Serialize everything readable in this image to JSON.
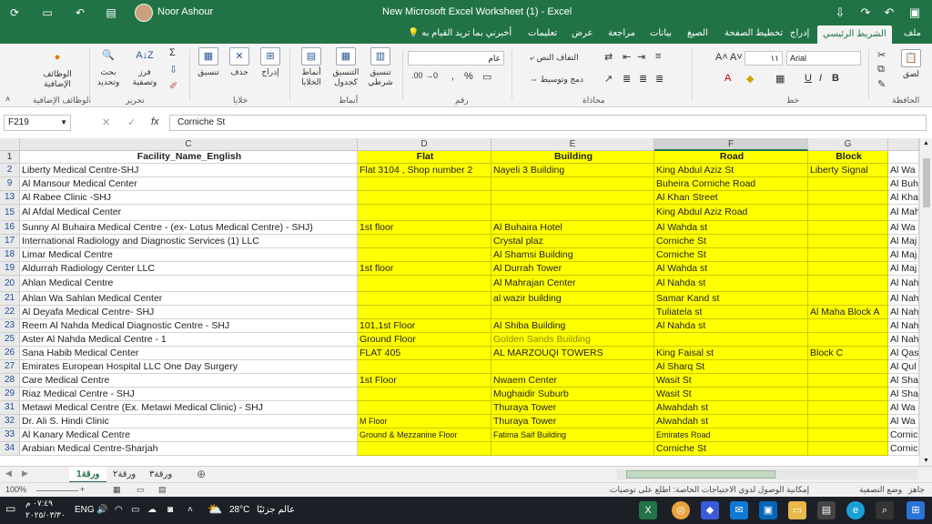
{
  "titlebar": {
    "user_name": "Noor Ashour",
    "title": "New Microsoft Excel Worksheet (1)  -  Excel",
    "icons": [
      "sync-icon",
      "undo-icon",
      "redo-icon",
      "save-icon"
    ]
  },
  "ribbon_tabs": [
    "ملف",
    "الشريط الرئيسي",
    "إدراج",
    "تخطيط الصفحة",
    "الصيغ",
    "بيانات",
    "مراجعة",
    "عرض",
    "تعليمات"
  ],
  "tell_me": "أخبرني بما تريد القيام به",
  "ribbon": {
    "groups": {
      "clipboard": "الحافظة",
      "font": "خط",
      "alignment": "محاذاة",
      "number": "رقم",
      "styles": "أنماط",
      "cells": "خلايا",
      "editing": "تحرير",
      "addins": "الوظائف الإضافية"
    },
    "paste": "لصق",
    "font_name": "Arial",
    "font_size": "١١",
    "number_format": "عام",
    "wrap_text": "التفاف النص",
    "merge_center": "دمج وتوسيط",
    "conditional_formatting_1": "تنسيق",
    "conditional_formatting_2": "شرطي",
    "format_as_table_1": "التنسيق",
    "format_as_table_2": "كجدول",
    "cell_styles_1": "أنماط",
    "cell_styles_2": "الخلايا",
    "insert": "إدراج",
    "delete": "حذف",
    "format": "تنسيق",
    "sort_filter_1": "فرز",
    "sort_filter_2": "وتصفية",
    "find_select_1": "بحث",
    "find_select_2": "وتحديد",
    "addins_1": "الوظائف",
    "addins_2": "الإضافية"
  },
  "formula_bar": {
    "name_box": "F219",
    "fx": "fx",
    "value": "Corniche St"
  },
  "columns": [
    "C",
    "D",
    "E",
    "F",
    "G"
  ],
  "header_row": {
    "num": "1",
    "cells": [
      "Facility_Name_English",
      "Flat",
      "Building",
      "Road",
      "Block",
      ""
    ]
  },
  "rows": [
    {
      "num": "2",
      "c": "Liberty Medical Centre-SHJ",
      "d": "Flat 3104 , Shop number 2",
      "e": "Nayeli 3 Building",
      "f": " King Abdul Aziz St",
      "g": "Liberty Signal",
      "h": "Al Wa"
    },
    {
      "num": "9",
      "c": "Al Mansour Medical Center",
      "d": "",
      "e": "",
      "f": "Buheira Corniche Road",
      "g": "",
      "h": "Al Buh"
    },
    {
      "num": "13",
      "c": "Al Rabee Clinic -SHJ",
      "d": "",
      "e": "",
      "f": "Al Khan Street",
      "g": "",
      "h": "Al Kha"
    },
    {
      "num": "15",
      "c": "Al Afdal Medical Center",
      "d": "",
      "e": "",
      "f": "King Abdul Aziz Road",
      "g": "",
      "h": "Al Mah"
    },
    {
      "num": "16",
      "c": "Sunny Al Buhaira Medical Centre - (ex- Lotus Medical Centre)  - SHJ)",
      "d": "1st floor",
      "e": "Al Buhaira Hotel",
      "f": "Al Wahda st",
      "g": "",
      "h": "Al Wa"
    },
    {
      "num": "17",
      "c": "International Radiology and Diagnostic Services (1) LLC",
      "d": "",
      "e": "Crystal plaz",
      "f": "Corniche St",
      "g": "",
      "h": "Al Maj"
    },
    {
      "num": "18",
      "c": "Limar Medical Centre",
      "d": "",
      "e": "Al Shamsi Building",
      "f": "Corniche St",
      "g": "",
      "h": "Al Maj"
    },
    {
      "num": "19",
      "c": "Aldurrah Radiology Center LLC",
      "d": "1st floor",
      "e": "Al Durrah Tower",
      "f": "Al Wahda st",
      "g": "",
      "h": "Al Maj"
    },
    {
      "num": "20",
      "c": "Ahlan Medical Centre",
      "d": "",
      "e": "Al Mahrajan Center",
      "f": "Al Nahda st",
      "g": "",
      "h": "Al Nah"
    },
    {
      "num": "21",
      "c": "Ahlan Wa Sahlan Medical Center",
      "d": "",
      "e": "al wazir building",
      "f": "Samar Kand st",
      "g": "",
      "h": "Al Nah"
    },
    {
      "num": "22",
      "c": "Al Deyafa Medical Centre- SHJ",
      "d": "",
      "e": "",
      "f": "Tuliatela st",
      "g": "Al Maha Block A",
      "h": "Al Nah"
    },
    {
      "num": "23",
      "c": "Reem Al Nahda Medical Diagnostic Centre - SHJ",
      "d": "101,1st Floor",
      "e": " Al Shiba Building",
      "f": "Al Nahda st",
      "g": "",
      "h": "Al Nah"
    },
    {
      "num": "25",
      "c": "Aster Al Nahda Medical Centre - 1",
      "d": "Ground Floor",
      "e": "Golden Sands Building",
      "f": "",
      "g": "",
      "h": "Al Nah"
    },
    {
      "num": "26",
      "c": "Sana Habib Medical Center",
      "d": "FLAT 405",
      "e": "AL MARZOUQI TOWERS",
      "f": "King Faisal st",
      "g": "Block C",
      "h": "Al Qas"
    },
    {
      "num": "27",
      "c": "Emirates European Hospital LLC One Day Surgery",
      "d": "",
      "e": "",
      "f": "Al Sharq St",
      "g": "",
      "h": "Al Qul"
    },
    {
      "num": "28",
      "c": "Care Medical Centre",
      "d": "1st Floor",
      "e": "Nwaem Center",
      "f": "Wasit St",
      "g": "",
      "h": "Al Sha"
    },
    {
      "num": "29",
      "c": "Riaz Medical Centre - SHJ",
      "d": "",
      "e": "Mughaidir Suburb",
      "f": " Wasit St",
      "g": "",
      "h": "Al Sha"
    },
    {
      "num": "31",
      "c": "Metawi Medical Centre (Ex. Metawi Medical Clinic)  - SHJ",
      "d": "",
      "e": "Thuraya Tower",
      "f": "Alwahdah st",
      "g": "",
      "h": "Al Wa"
    },
    {
      "num": "32",
      "c": "Dr. Ali S. Hindi Clinic",
      "d": "M Floor",
      "e": "Thuraya Tower",
      "f": "Alwahdah st",
      "g": "",
      "h": "Al Wa"
    },
    {
      "num": "33",
      "c": "Al Kanary Medical Centre",
      "d": "Ground & Mezzanine Floor",
      "e": "Fatima Saif Building",
      "f": "Emirates Road",
      "g": "",
      "h": "Cornic"
    },
    {
      "num": "34",
      "c": "Arabian Medical Centre-Sharjah",
      "d": "",
      "e": "",
      "f": "Corniche St",
      "g": "",
      "h": "Cornic"
    }
  ],
  "sheets": [
    "ورقة1",
    "ورقة٢",
    "ورقة٣"
  ],
  "status": {
    "ready": "جاهز",
    "mode": "وضع التصفية",
    "accessibility": "إمكانية الوصول لذوي الاحتياجات الخاصة: اطلع على توصيات",
    "zoom": "100%"
  },
  "taskbar": {
    "time": "٠٧:٤٩ م",
    "date": "٢٠٢٥/٠٣/٣٠",
    "lang": "ENG",
    "weather_temp": "28°C",
    "weather_text": "عالم جزئيًا"
  },
  "colors": {
    "excel_green": "#217346",
    "highlight": "#ffff00"
  }
}
